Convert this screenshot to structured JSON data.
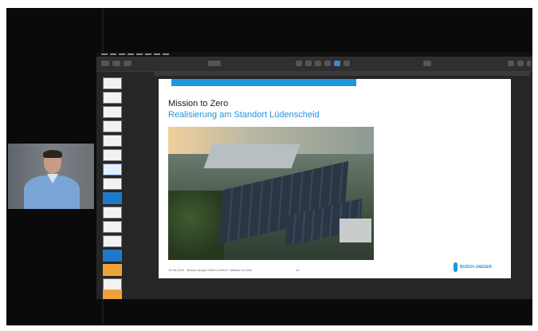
{
  "slide": {
    "title": "Mission to Zero",
    "subtitle": "Realisierung am Standort Lüdenscheid",
    "footer": "10.06.2020 · Busch-Jaeger Elektro GmbH · Mission to Zero",
    "page_number": "10",
    "logo_text": "BUSCH-JAEGER"
  },
  "colors": {
    "accent": "#1f95dc",
    "toolbar_blue": "#3a86d6",
    "thumb_orange": "#f0a23a"
  }
}
